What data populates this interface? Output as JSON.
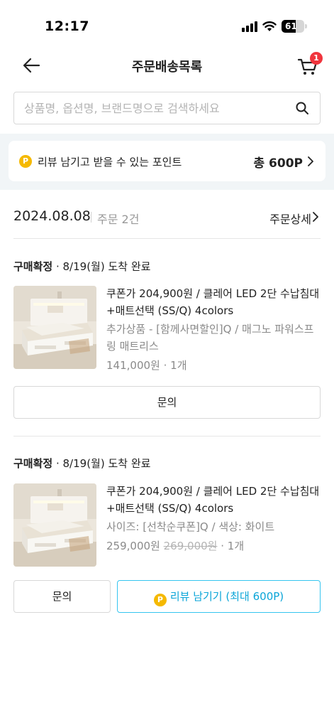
{
  "status_bar": {
    "time": "12:17",
    "battery": "61"
  },
  "header": {
    "title": "주문배송목록",
    "cart_count": "1"
  },
  "search": {
    "placeholder": "상품명, 옵션명, 브랜드명으로 검색하세요",
    "value": ""
  },
  "point_banner": {
    "coin_symbol": "P",
    "label": "리뷰 남기고 받을 수 있는 포인트",
    "total": "총 600P"
  },
  "order": {
    "date": "2024.08.08",
    "count": "주문 2건",
    "detail_label": "주문상세"
  },
  "items": [
    {
      "status": "구매확정",
      "delivery": " · 8/19(월) 도착 완료",
      "name": "쿠폰가 204,900원 / 클레어 LED 2단 수납침대+매트선택 (SS/Q) 4colors",
      "option": "추가상품 - [함께사면할인]Q / 매그노 파워스프링 매트리스",
      "price": "141,000원",
      "original_price": "",
      "qty": " · 1개",
      "inquiry_label": "문의"
    },
    {
      "status": "구매확정",
      "delivery": " · 8/19(월) 도착 완료",
      "name": "쿠폰가 204,900원 / 클레어 LED 2단 수납침대+매트선택 (SS/Q) 4colors",
      "option": "사이즈: [선착순쿠폰]Q / 색상: 화이트",
      "price": "259,000원",
      "original_price": "269,000원",
      "qty": " · 1개",
      "inquiry_label": "문의",
      "review_label": "리뷰 남기기 (최대 600P)"
    }
  ],
  "colors": {
    "accent": "#35c5f0",
    "coin": "#f5b900",
    "badge": "#f0353d"
  }
}
